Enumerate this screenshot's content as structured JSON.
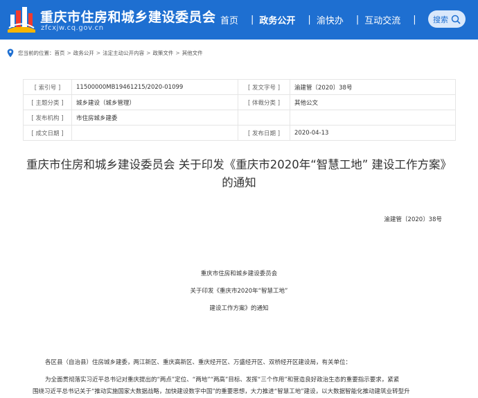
{
  "header": {
    "site_name": "重庆市住房和城乡建设委员会",
    "site_domain": "zfcxjw.cq.gov.cn",
    "nav": [
      {
        "label": "首页",
        "active": false
      },
      {
        "label": "政务公开",
        "active": true
      },
      {
        "label": "渝快办",
        "active": false
      },
      {
        "label": "互动交流",
        "active": false
      }
    ],
    "nav_separator": "|",
    "search_label": "搜索",
    "colors": {
      "header_bg": "#1e6fd1",
      "search_bg": "#d9e8fb"
    }
  },
  "breadcrumb": {
    "icon": "location-pin-icon",
    "prefix": "您当前的位置：",
    "items": [
      "首页",
      "政务公开",
      "法定主动公开内容",
      "政策文件",
      "其他文件"
    ],
    "separator": ">"
  },
  "info_table": {
    "rows": [
      [
        "[ 索引号 ]",
        "11500000MB19461215/2020-01099",
        "[ 发文字号 ]",
        "渝建管〔2020〕38号"
      ],
      [
        "[ 主题分类 ]",
        "城乡建设（城乡管理）",
        "[ 体裁分类 ]",
        "其他公文"
      ],
      [
        "[ 发布机构 ]",
        "市住房城乡建委",
        "",
        ""
      ],
      [
        "[ 成文日期 ]",
        "",
        "[ 发布日期 ]",
        "2020-04-13"
      ]
    ]
  },
  "document": {
    "title_line1": "重庆市住房和城乡建设委员会 关于印发《重庆市2020年“智慧工地” 建设工作方案》",
    "title_line2": "的通知",
    "number": "渝建管〔2020〕38号",
    "header_lines": [
      "重庆市住房和城乡建设委员会",
      "关于印发《重庆市2020年“智慧工地”",
      "建设工作方案》的通知"
    ],
    "paragraphs": [
      "各区县（自治县）住房城乡建委，两江新区、重庆高新区、重庆经开区、万盛经开区、双桥经开区建设局，有关单位：",
      "为全面贯彻落实习近平总书记对重庆提出的“两点”定位、“两地”“两高”目标、发挥“三个作用”和营造良好政治生态的重要指示要求，紧紧",
      "围绕习近平总书记关于“推动实施国家大数据战略，加快建设数字中国”的重要思想，大力推进“智慧工地”建设，以大数据智能化推动建筑业转型升"
    ]
  }
}
